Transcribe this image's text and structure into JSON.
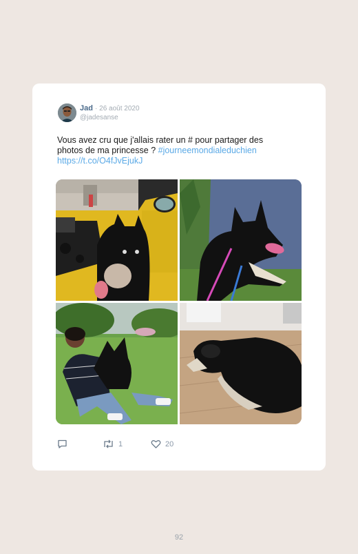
{
  "tweet": {
    "author_name": "Jad",
    "date": "· 26 août 2020",
    "handle": "@jadesanse",
    "text_plain": "Vous avez cru que j'allais rater un # pour partager des photos de ma princesse ? ",
    "hashtag": "#journeemondialeduchien",
    "url": "https://t.co/O4fJvEjukJ",
    "photos": [
      {
        "name": "dog-in-yellow-car"
      },
      {
        "name": "dog-by-lake"
      },
      {
        "name": "person-hugging-dog"
      },
      {
        "name": "dog-lying-on-floor"
      }
    ],
    "reply_count": "",
    "retweet_count": "1",
    "like_count": "20"
  },
  "page": {
    "number": "92"
  },
  "colors": {
    "background": "#eee7e2",
    "card": "#ffffff",
    "link": "#5aa9e6",
    "name": "#4a6a8a"
  },
  "icons": [
    "reply-icon",
    "retweet-icon",
    "heart-icon"
  ]
}
